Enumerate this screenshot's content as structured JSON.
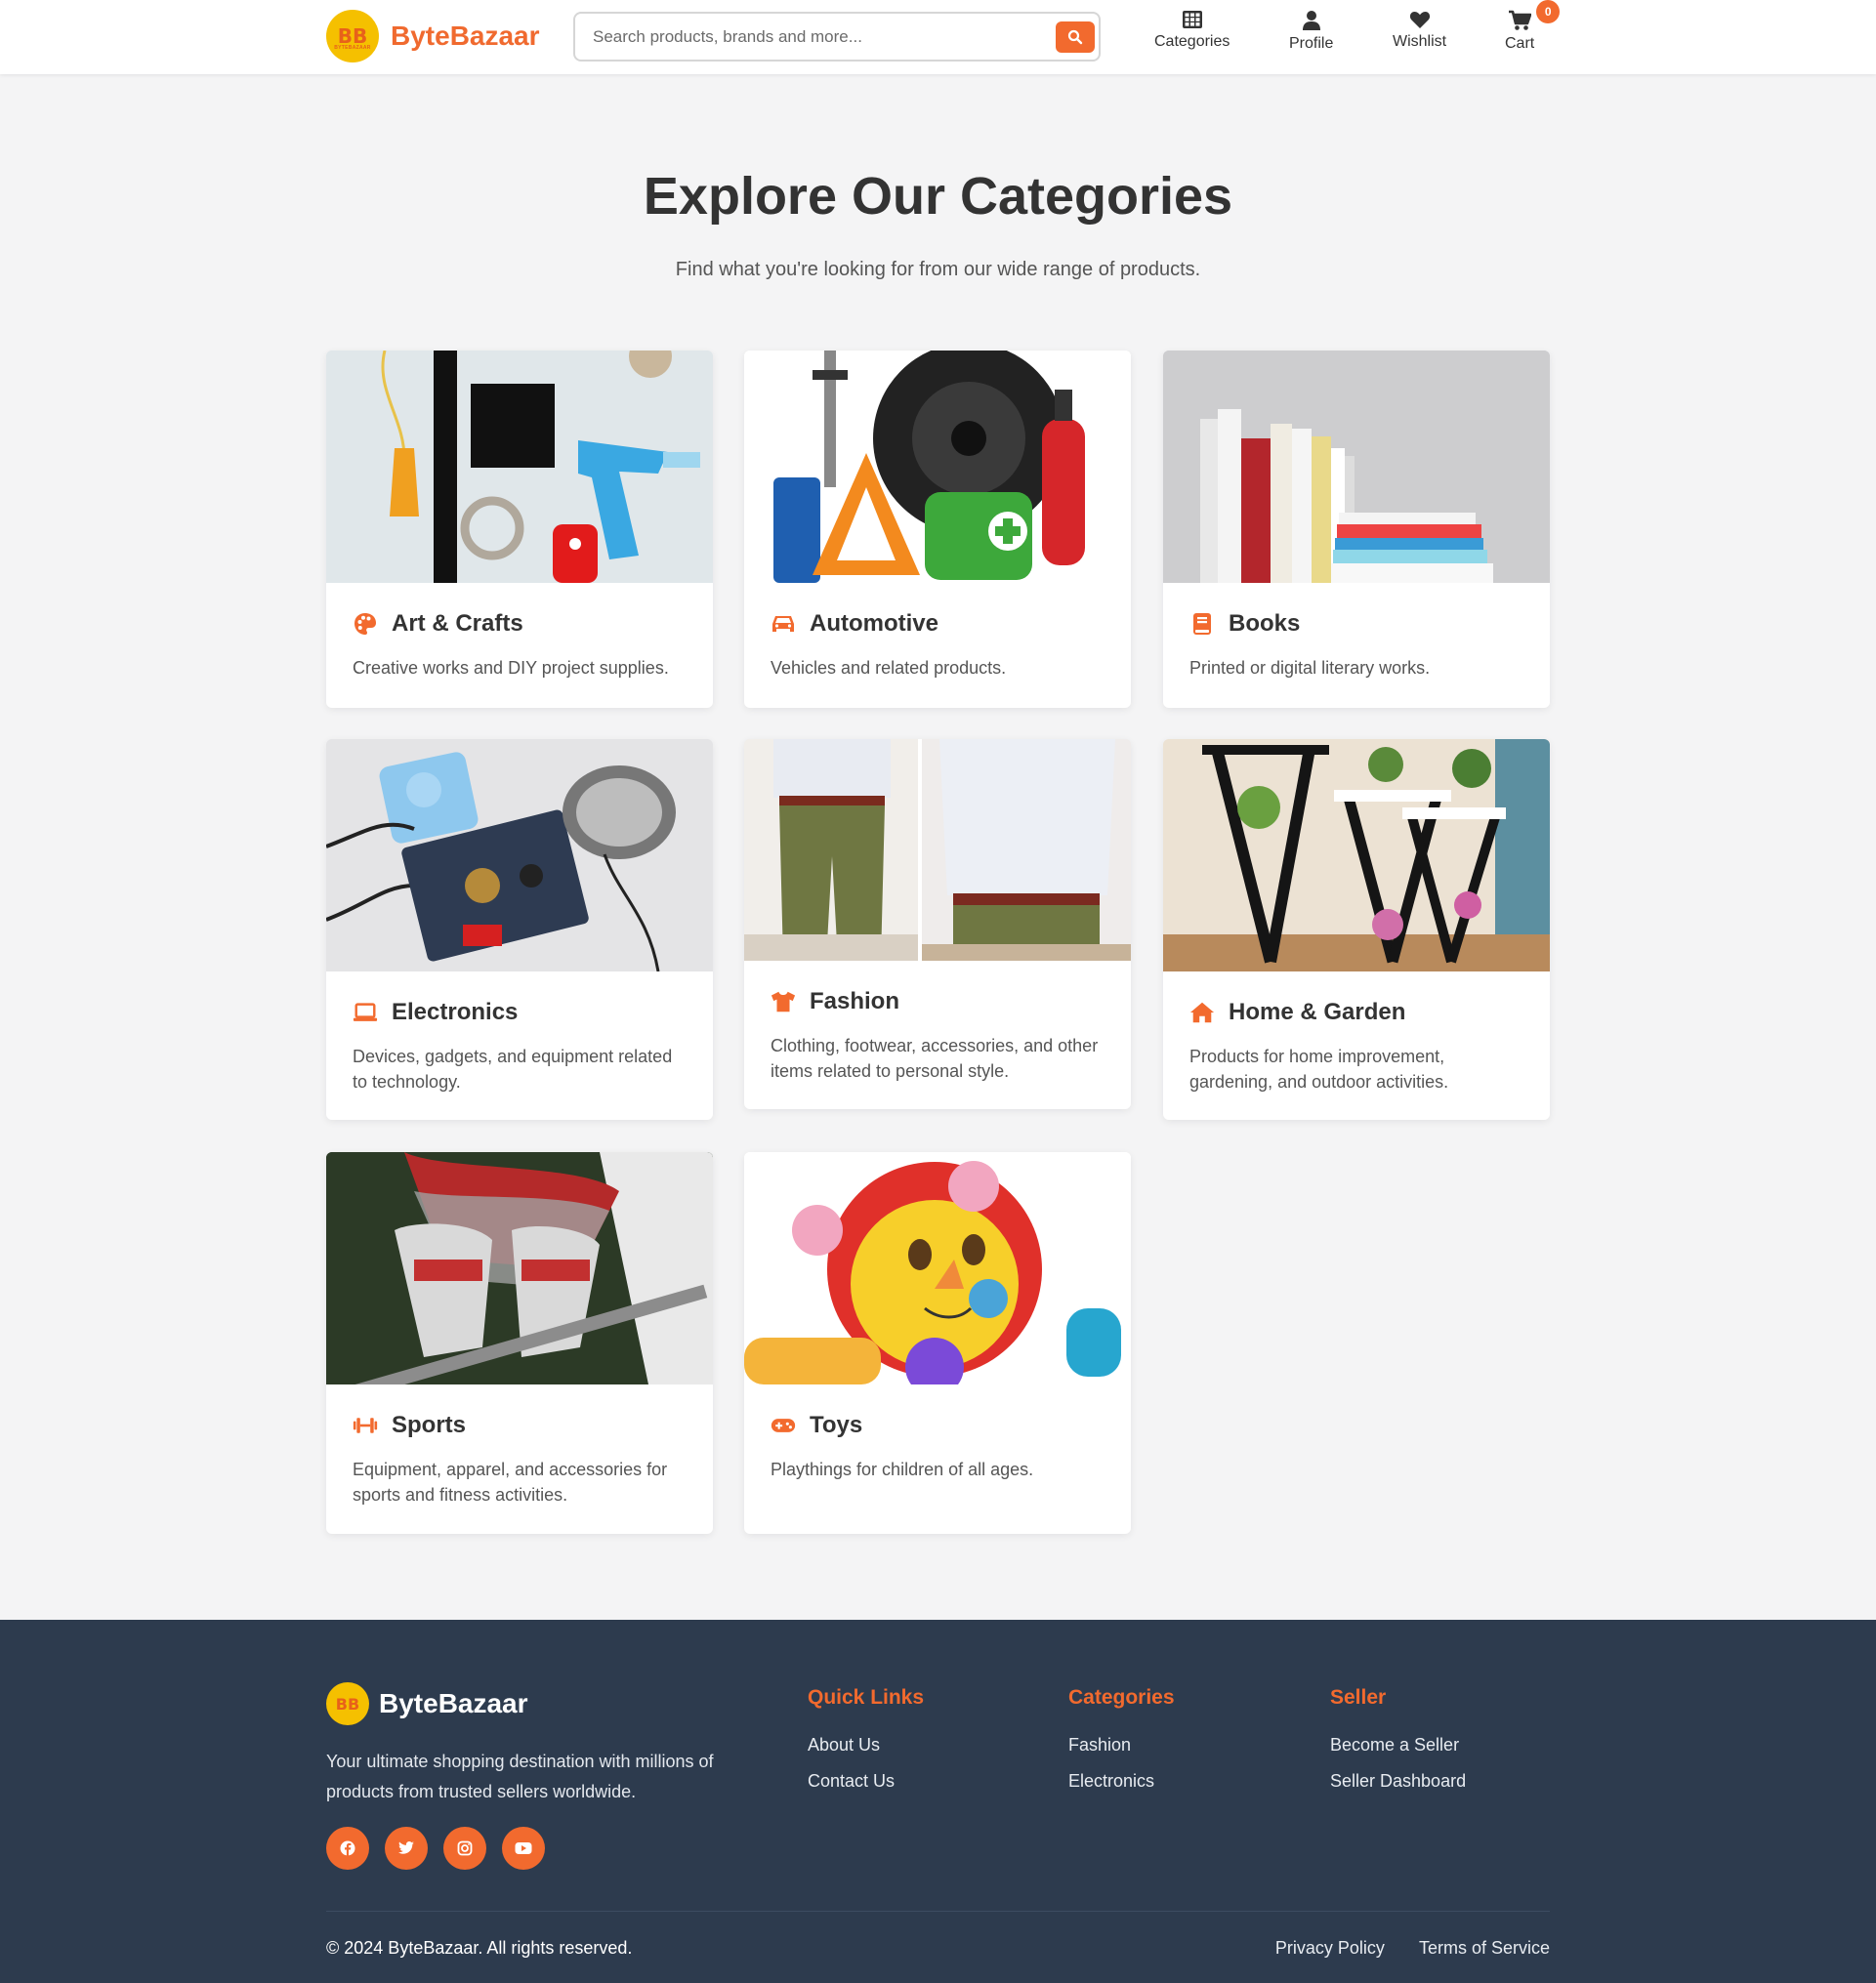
{
  "brand": {
    "name": "ByteBazaar",
    "badge_text": "BB",
    "badge_subtext": "BYTEBAZAAR",
    "accent": "#f26a2e",
    "badge_color": "#f5c000"
  },
  "search": {
    "placeholder": "Search products, brands and more...",
    "icon": "search-icon"
  },
  "nav": [
    {
      "label": "Categories",
      "icon": "grid-icon"
    },
    {
      "label": "Profile",
      "icon": "user-icon"
    },
    {
      "label": "Wishlist",
      "icon": "heart-icon"
    },
    {
      "label": "Cart",
      "icon": "cart-icon",
      "badge": "0"
    }
  ],
  "hero": {
    "title": "Explore Our Categories",
    "subtitle": "Find what you're looking for from our wide range of products."
  },
  "categories": [
    {
      "name": "Art & Crafts",
      "description": "Creative works and DIY project supplies.",
      "icon": "palette-icon"
    },
    {
      "name": "Automotive",
      "description": "Vehicles and related products.",
      "icon": "car-icon"
    },
    {
      "name": "Books",
      "description": "Printed or digital literary works.",
      "icon": "book-icon"
    },
    {
      "name": "Electronics",
      "description": "Devices, gadgets, and equipment related to technology.",
      "icon": "laptop-icon"
    },
    {
      "name": "Fashion",
      "description": "Clothing, footwear, accessories, and other items related to personal style.",
      "icon": "shirt-icon"
    },
    {
      "name": "Home & Garden",
      "description": "Products for home improvement, gardening, and outdoor activities.",
      "icon": "home-icon"
    },
    {
      "name": "Sports",
      "description": "Equipment, apparel, and accessories for sports and fitness activities.",
      "icon": "dumbbell-icon"
    },
    {
      "name": "Toys",
      "description": "Playthings for children of all ages.",
      "icon": "gamepad-icon"
    }
  ],
  "footer": {
    "brand": "ByteBazaar",
    "tagline": "Your ultimate shopping destination with millions of products from trusted sellers worldwide.",
    "socials": [
      "facebook-icon",
      "twitter-icon",
      "instagram-icon",
      "youtube-icon"
    ],
    "columns": [
      {
        "heading": "Quick Links",
        "links": [
          "About Us",
          "Contact Us"
        ]
      },
      {
        "heading": "Categories",
        "links": [
          "Fashion",
          "Electronics"
        ]
      },
      {
        "heading": "Seller",
        "links": [
          "Become a Seller",
          "Seller Dashboard"
        ]
      }
    ],
    "copyright": "© 2024 ByteBazaar. All rights reserved.",
    "legal": [
      "Privacy Policy",
      "Terms of Service"
    ]
  }
}
